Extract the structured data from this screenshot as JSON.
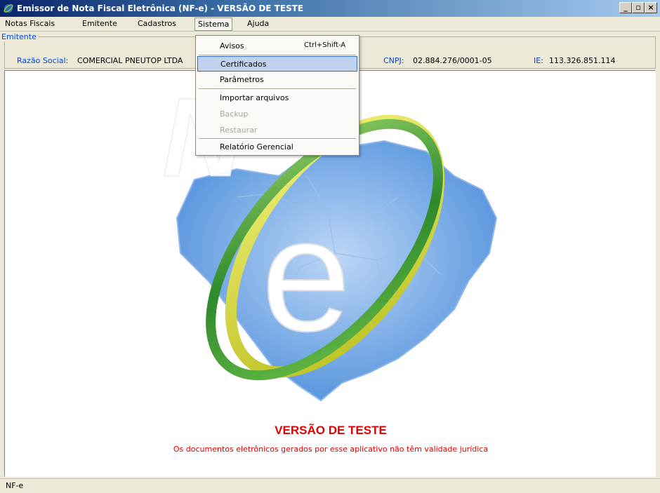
{
  "window": {
    "title": "Emissor de Nota Fiscal Eletrônica (NF-e) - VERSÃO DE TESTE",
    "controls": [
      "_",
      "▫",
      "×"
    ]
  },
  "menubar": {
    "items": [
      {
        "label": "Notas Fiscais"
      },
      {
        "label": "Emitente"
      },
      {
        "label": "Cadastros"
      },
      {
        "label": "Sistema"
      },
      {
        "label": "Ajuda"
      }
    ]
  },
  "emitente": {
    "legend": "Emitente",
    "razao_label": "Razão Social:",
    "razao_value": "COMERCIAL PNEUTOP LTDA",
    "cnpj_label": "CNPJ:",
    "cnpj_value": "02.884.276/0001-05",
    "ie_label": "IE:",
    "ie_value": "113.326.851.114"
  },
  "sistema_menu": {
    "items": [
      {
        "label": "Avisos",
        "shortcut": "Ctrl+Shift-A",
        "enabled": true
      },
      {
        "label": "Certificados",
        "enabled": true,
        "highlighted": true
      },
      {
        "label": "Parâmetros",
        "enabled": true
      },
      {
        "label": "Importar arquivos",
        "enabled": true
      },
      {
        "label": "Backup",
        "enabled": false
      },
      {
        "label": "Restaurar",
        "enabled": false
      },
      {
        "label": "Relatório Gerencial",
        "enabled": true
      }
    ]
  },
  "main": {
    "logo_icon": "nfe-logo",
    "versao": "VERSÃO DE TESTE",
    "aviso": "Os documentos eletrônicos gerados por esse aplicativo não têm validade jurídica"
  },
  "statusbar": {
    "text": "NF-e"
  },
  "colors": {
    "accent_blue": "#0046d5",
    "warning_red": "#e20000",
    "highlight": "#c1d2ee"
  }
}
